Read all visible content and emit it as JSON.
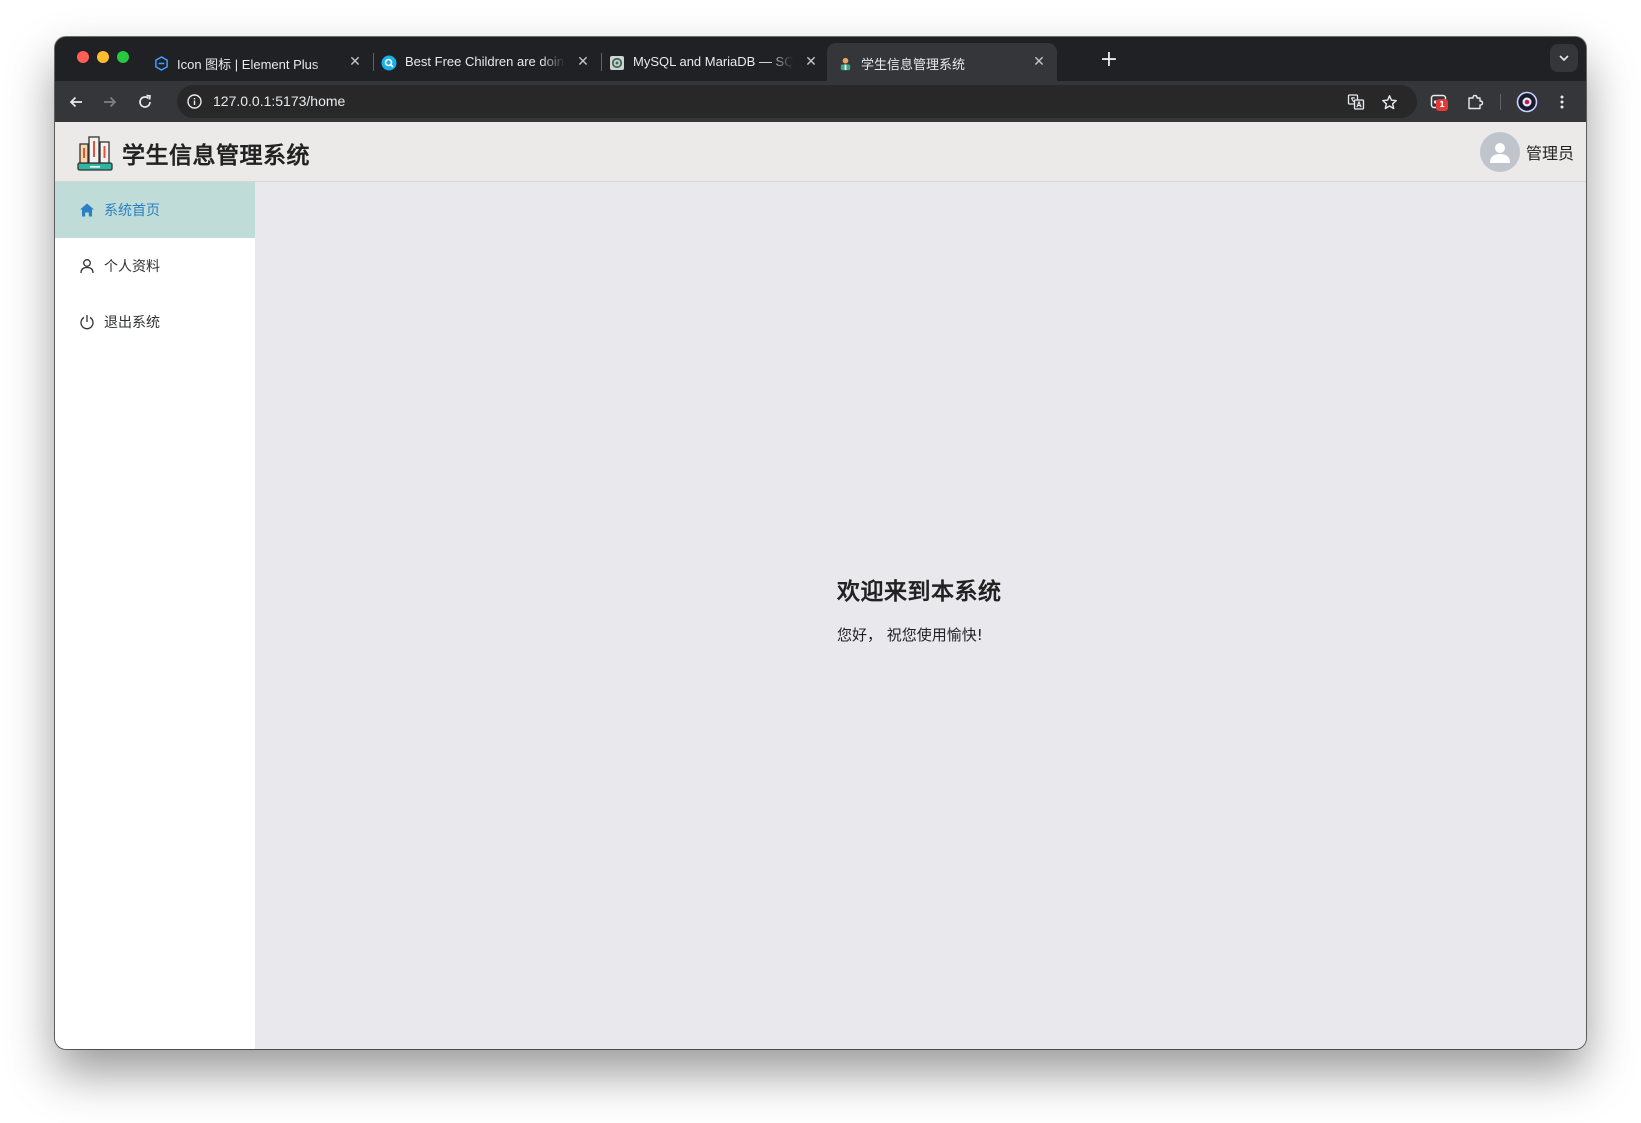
{
  "browser": {
    "tabs": [
      {
        "title": "Icon 图标 | Element Plus",
        "favicon": "element-plus-icon",
        "active": false
      },
      {
        "title": "Best Free Children are doing activities",
        "favicon": "search-app-icon",
        "active": false
      },
      {
        "title": "MySQL and MariaDB — SQLAlchemy",
        "favicon": "sqlalchemy-icon",
        "active": false
      },
      {
        "title": "学生信息管理系统",
        "favicon": "student-app-icon",
        "active": true
      }
    ],
    "new_tab_label": "+",
    "close_label": "✕",
    "url": "127.0.0.1:5173/home",
    "extension_badge": "1"
  },
  "app": {
    "title": "学生信息管理系统",
    "user": {
      "name": "管理员"
    },
    "menu": [
      {
        "label": "系统首页",
        "icon": "home-icon",
        "active": true
      },
      {
        "label": "个人资料",
        "icon": "user-icon",
        "active": false
      },
      {
        "label": "退出系统",
        "icon": "power-icon",
        "active": false
      }
    ],
    "welcome": {
      "heading": "欢迎来到本系统",
      "message": "您好， 祝您使用愉快!"
    }
  },
  "colors": {
    "accent": "#2b7fc3",
    "menu_active_bg": "#c0dcd8",
    "main_bg": "#e9e9ed",
    "header_bg": "#ebeae9"
  }
}
